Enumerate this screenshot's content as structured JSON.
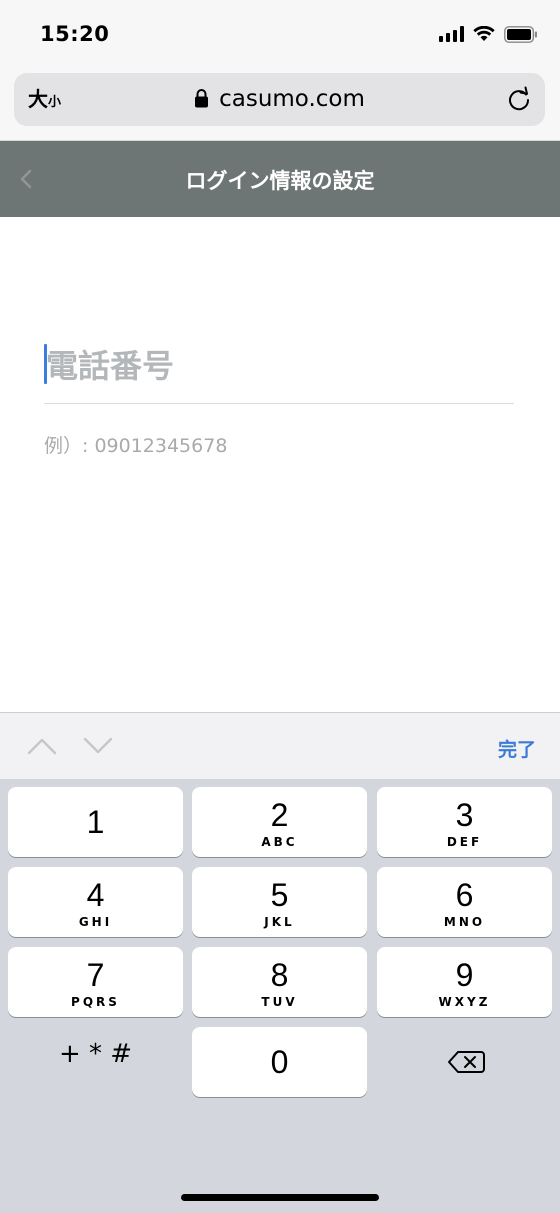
{
  "status_bar": {
    "time": "15:20"
  },
  "browser": {
    "text_size_large": "大",
    "text_size_small": "小",
    "url": "casumo.com"
  },
  "header": {
    "title": "ログイン情報の設定"
  },
  "form": {
    "phone_placeholder": "電話番号",
    "example": "例）: 09012345678"
  },
  "accessory": {
    "done_label": "完了"
  },
  "keypad": {
    "keys": [
      {
        "num": "1",
        "letters": ""
      },
      {
        "num": "2",
        "letters": "ABC"
      },
      {
        "num": "3",
        "letters": "DEF"
      },
      {
        "num": "4",
        "letters": "GHI"
      },
      {
        "num": "5",
        "letters": "JKL"
      },
      {
        "num": "6",
        "letters": "MNO"
      },
      {
        "num": "7",
        "letters": "PQRS"
      },
      {
        "num": "8",
        "letters": "TUV"
      },
      {
        "num": "9",
        "letters": "WXYZ"
      },
      {
        "num": "0",
        "letters": ""
      }
    ],
    "symbols": "+ * #"
  },
  "icons": {
    "signal": "signal-icon",
    "wifi": "wifi-icon",
    "battery": "battery-icon",
    "lock": "lock-icon",
    "reload": "reload-icon",
    "back": "chevron-left-icon",
    "prev": "chevron-up-icon",
    "next": "chevron-down-icon",
    "delete": "delete-icon"
  },
  "colors": {
    "header_bg": "#6e7675",
    "caret": "#3b7ee0",
    "done": "#3a7bd5",
    "keypad_bg": "#d3d6dc"
  }
}
